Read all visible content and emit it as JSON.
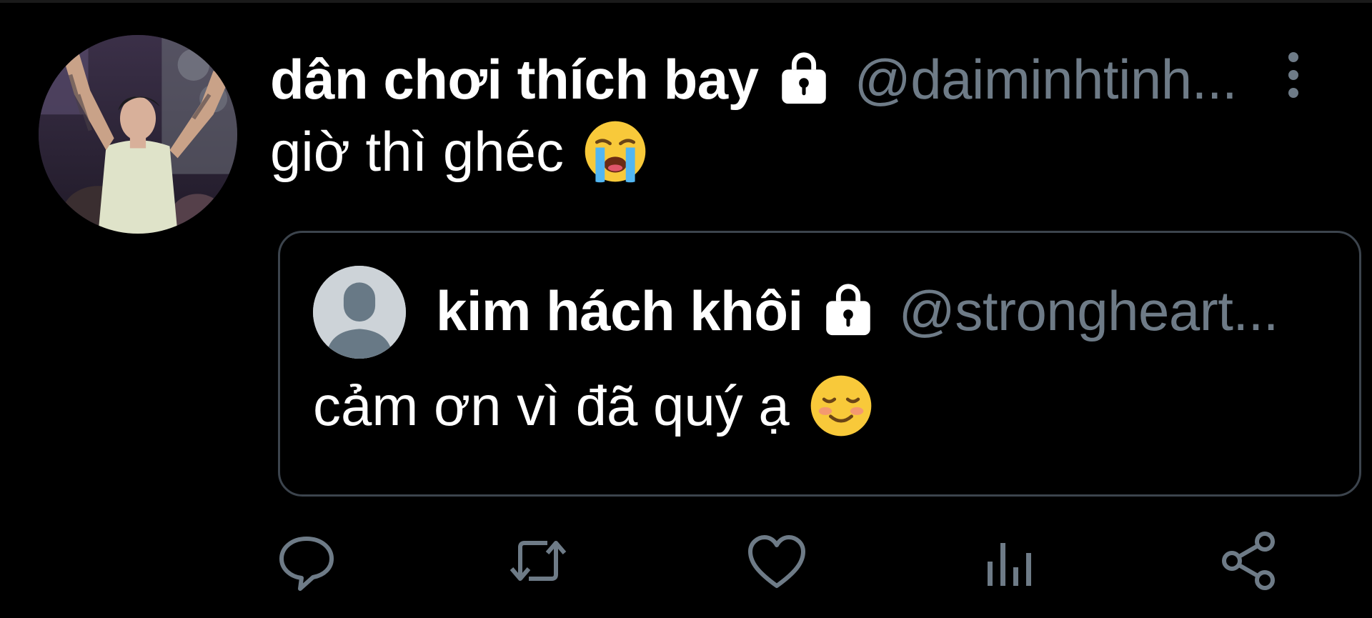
{
  "tweet": {
    "author": {
      "display_name": "dân chơi thích bay",
      "handle": "@daiminhtinh...",
      "protected": true,
      "avatar": "profile-photo"
    },
    "text": "giờ thì ghéc",
    "emoji": "loudly-crying-face-emoji",
    "quoted": {
      "author": {
        "display_name": "kim hách khôi",
        "handle": "@strongheart...",
        "protected": true,
        "avatar": "default-avatar"
      },
      "text": "cảm ơn vì đã quý ạ",
      "emoji": "smiling-face-emoji"
    },
    "actions": [
      {
        "name": "reply",
        "icon": "reply-icon"
      },
      {
        "name": "retweet",
        "icon": "retweet-icon"
      },
      {
        "name": "like",
        "icon": "heart-icon"
      },
      {
        "name": "views",
        "icon": "views-icon"
      },
      {
        "name": "share",
        "icon": "share-icon"
      }
    ]
  },
  "colors": {
    "background": "#000000",
    "text": "#ffffff",
    "secondary": "#6e7b87",
    "border": "#3c444d",
    "icon": "#6e7b87"
  }
}
